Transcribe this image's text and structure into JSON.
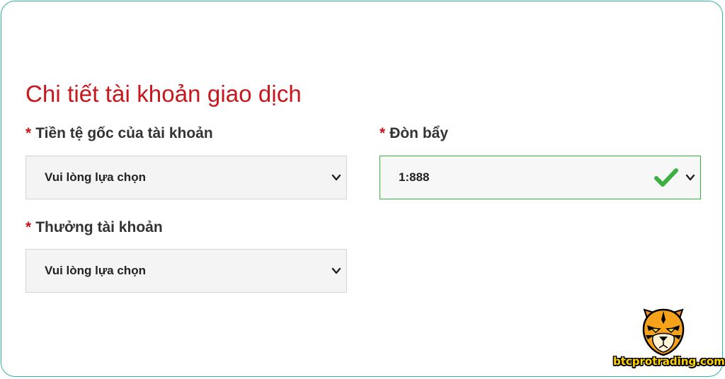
{
  "section_title": "Chi tiết tài khoản giao dịch",
  "required_mark": "*",
  "fields": {
    "base_currency": {
      "label": "Tiền tệ gốc của tài khoản",
      "value": "Vui lòng lựa chọn"
    },
    "leverage": {
      "label": "Đòn bẩy",
      "value": "1:888",
      "valid": true
    },
    "account_bonus": {
      "label": "Thưởng tài khoản",
      "value": "Vui lòng lựa chọn"
    }
  },
  "watermark": {
    "site": "btcprotrading.com",
    "icon": "tiger-head-icon"
  },
  "colors": {
    "title": "#c7161c",
    "required": "#c7161c",
    "valid_border": "#3cb043",
    "check": "#3cb043",
    "frame": "#2fb3a6"
  }
}
